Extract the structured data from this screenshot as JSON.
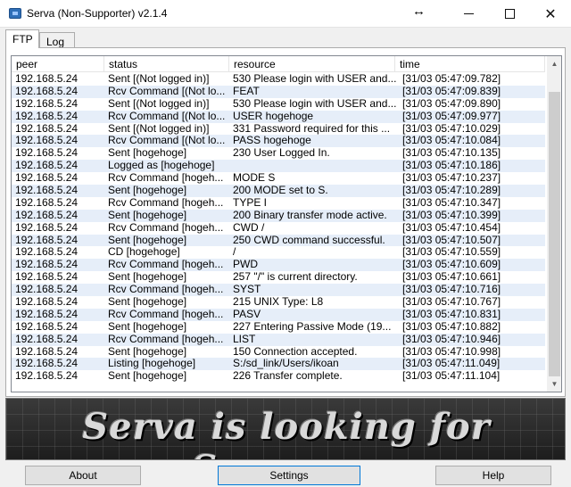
{
  "window": {
    "title": "Serva (Non-Supporter) v2.1.4",
    "resize_glyph": "↔",
    "minimize_icon": "minimize-icon",
    "maximize_icon": "maximize-icon",
    "close_glyph": "✕"
  },
  "tabs": [
    {
      "label": "FTP",
      "active": true
    },
    {
      "label": "Log",
      "active": false
    }
  ],
  "columns": [
    "peer",
    "status",
    "resource",
    "time"
  ],
  "rows": [
    {
      "peer": "192.168.5.24",
      "status": "Sent [(Not logged in)]",
      "resource": "530 Please login with USER and...",
      "time": "[31/03 05:47:09.782]"
    },
    {
      "peer": "192.168.5.24",
      "status": "Rcv Command [(Not lo...",
      "resource": "FEAT",
      "time": "[31/03 05:47:09.839]"
    },
    {
      "peer": "192.168.5.24",
      "status": "Sent [(Not logged in)]",
      "resource": "530 Please login with USER and...",
      "time": "[31/03 05:47:09.890]"
    },
    {
      "peer": "192.168.5.24",
      "status": "Rcv Command [(Not lo...",
      "resource": "USER hogehoge",
      "time": "[31/03 05:47:09.977]"
    },
    {
      "peer": "192.168.5.24",
      "status": "Sent [(Not logged in)]",
      "resource": "331 Password required for this ...",
      "time": "[31/03 05:47:10.029]"
    },
    {
      "peer": "192.168.5.24",
      "status": "Rcv Command [(Not lo...",
      "resource": "PASS hogehoge",
      "time": "[31/03 05:47:10.084]"
    },
    {
      "peer": "192.168.5.24",
      "status": "Sent [hogehoge]",
      "resource": "230 User Logged In.",
      "time": "[31/03 05:47:10.135]"
    },
    {
      "peer": "192.168.5.24",
      "status": "Logged as [hogehoge]",
      "resource": "",
      "time": "[31/03 05:47:10.186]"
    },
    {
      "peer": "192.168.5.24",
      "status": "Rcv Command [hogeh...",
      "resource": "MODE S",
      "time": "[31/03 05:47:10.237]"
    },
    {
      "peer": "192.168.5.24",
      "status": "Sent [hogehoge]",
      "resource": "200 MODE set to S.",
      "time": "[31/03 05:47:10.289]"
    },
    {
      "peer": "192.168.5.24",
      "status": "Rcv Command [hogeh...",
      "resource": "TYPE I",
      "time": "[31/03 05:47:10.347]"
    },
    {
      "peer": "192.168.5.24",
      "status": "Sent [hogehoge]",
      "resource": "200 Binary transfer mode active.",
      "time": "[31/03 05:47:10.399]"
    },
    {
      "peer": "192.168.5.24",
      "status": "Rcv Command [hogeh...",
      "resource": "CWD /",
      "time": "[31/03 05:47:10.454]"
    },
    {
      "peer": "192.168.5.24",
      "status": "Sent [hogehoge]",
      "resource": "250 CWD command successful.",
      "time": "[31/03 05:47:10.507]"
    },
    {
      "peer": "192.168.5.24",
      "status": "CD [hogehoge]",
      "resource": "/",
      "time": "[31/03 05:47:10.559]"
    },
    {
      "peer": "192.168.5.24",
      "status": "Rcv Command [hogeh...",
      "resource": "PWD",
      "time": "[31/03 05:47:10.609]"
    },
    {
      "peer": "192.168.5.24",
      "status": "Sent [hogehoge]",
      "resource": "257 \"/\" is current directory.",
      "time": "[31/03 05:47:10.661]"
    },
    {
      "peer": "192.168.5.24",
      "status": "Rcv Command [hogeh...",
      "resource": "SYST",
      "time": "[31/03 05:47:10.716]"
    },
    {
      "peer": "192.168.5.24",
      "status": "Sent [hogehoge]",
      "resource": "215 UNIX Type: L8",
      "time": "[31/03 05:47:10.767]"
    },
    {
      "peer": "192.168.5.24",
      "status": "Rcv Command [hogeh...",
      "resource": "PASV",
      "time": "[31/03 05:47:10.831]"
    },
    {
      "peer": "192.168.5.24",
      "status": "Sent [hogehoge]",
      "resource": "227 Entering Passive Mode (19...",
      "time": "[31/03 05:47:10.882]"
    },
    {
      "peer": "192.168.5.24",
      "status": "Rcv Command [hogeh...",
      "resource": "LIST",
      "time": "[31/03 05:47:10.946]"
    },
    {
      "peer": "192.168.5.24",
      "status": "Sent [hogehoge]",
      "resource": "150 Connection accepted.",
      "time": "[31/03 05:47:10.998]"
    },
    {
      "peer": "192.168.5.24",
      "status": "Listing [hogehoge]",
      "resource": "S:/sd_link/Users/ikoan",
      "time": "[31/03 05:47:11.049]"
    },
    {
      "peer": "192.168.5.24",
      "status": "Sent [hogehoge]",
      "resource": "226 Transfer complete.",
      "time": "[31/03 05:47:11.104]"
    }
  ],
  "scrollbar": {
    "up_glyph": "▲",
    "down_glyph": "▼"
  },
  "banner": {
    "text": "Serva is looking for Sponsors"
  },
  "buttons": {
    "about": "About",
    "settings": "Settings",
    "help": "Help"
  }
}
